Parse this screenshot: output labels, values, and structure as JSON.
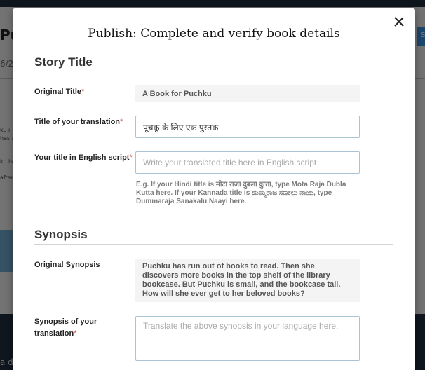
{
  "background": {
    "title_fragment": "Puc",
    "subtitle_fragment": "6/2",
    "snippets": [
      "ku i",
      "has a",
      "ku is",
      "after"
    ],
    "button_fragment": "S",
    "footer_fragment": "a d"
  },
  "modal": {
    "title": "Publish: Complete and verify book details",
    "close_icon": "close-icon"
  },
  "story_title": {
    "heading": "Story Title",
    "original_title_label": "Original Title",
    "original_title_value": "A Book for Puchku",
    "translation_label": "Title of your translation",
    "translation_value": "पूचकू के लिए एक पुस्तक",
    "english_script_label": "Your title in English script",
    "english_script_placeholder": "Write your translated title here in English script",
    "hint": "E.g. If your Hindi title is मोटा राजा दुबला कुत्ता, type Mota Raja Dubla Kutta here. If your Kannada title is ದುಮ್ಮರಾಜ ಸಣಕಲು ನಾಯಿ, type Dummaraja Sanakalu Naayi here."
  },
  "synopsis": {
    "heading": "Synopsis",
    "original_label": "Original Synopsis",
    "original_value": "Puchku has run out of books to read. Then she discovers more books in the top shelf of the library bookcase. But Puchku is small, and the bookcase tall. How will she ever get to her beloved books?",
    "translation_label_line1": "Synopsis of your",
    "translation_label_line2": "translation",
    "translation_placeholder": "Translate the above synopsis in your language here."
  },
  "required_marker": "*"
}
